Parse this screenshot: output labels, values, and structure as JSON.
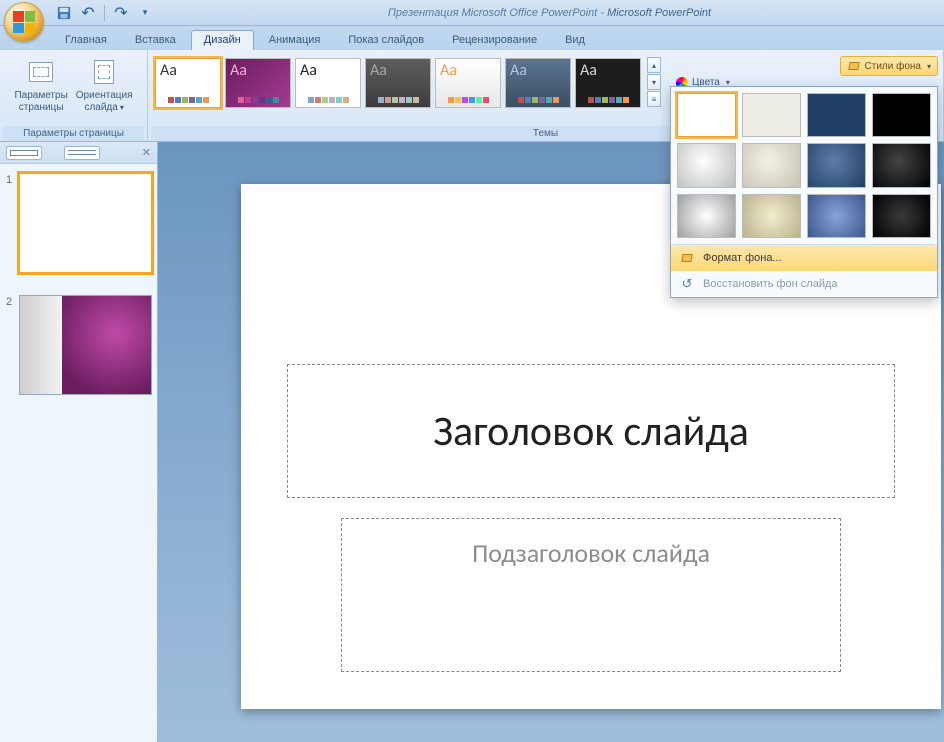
{
  "title": {
    "doc": "Презентация Microsoft Office PowerPoint",
    "app": "Microsoft PowerPoint"
  },
  "tabs": [
    {
      "label": "Главная"
    },
    {
      "label": "Вставка"
    },
    {
      "label": "Дизайн"
    },
    {
      "label": "Анимация"
    },
    {
      "label": "Показ слайдов"
    },
    {
      "label": "Рецензирование"
    },
    {
      "label": "Вид"
    }
  ],
  "ribbon": {
    "page_params": {
      "label": "Параметры страницы",
      "btn_page": [
        "Параметры",
        "страницы"
      ],
      "btn_orient": [
        "Ориентация",
        "слайда"
      ]
    },
    "themes": {
      "label": "Темы",
      "items": [
        {
          "aa_color": "#333333",
          "bg": "#ffffff",
          "swatches": [
            "#c0504d",
            "#4f81bd",
            "#9bbb59",
            "#8064a2",
            "#4bacc6",
            "#f79646"
          ]
        },
        {
          "aa_color": "#fbacd9",
          "bg": "linear-gradient(135deg,#6a1d60,#a43a90)",
          "swatches": [
            "#e3609e",
            "#c43a90",
            "#8a3a90",
            "#5d3a90",
            "#3a5f90",
            "#3a909e"
          ]
        },
        {
          "aa_color": "#222222",
          "bg": "#ffffff",
          "swatches": [
            "#7aa6d0",
            "#d07a7a",
            "#a6d07a",
            "#c6a6d0",
            "#7ad0c6",
            "#d0b07a"
          ]
        },
        {
          "aa_color": "#a8a8a8",
          "bg": "linear-gradient(#5e5e5e,#3c3c3c)",
          "swatches": [
            "#9bb1c9",
            "#c99b9b",
            "#b1c99b",
            "#c5b1c9",
            "#9bc9c5",
            "#c9bb9b"
          ]
        },
        {
          "aa_color": "#f79646",
          "bg": "linear-gradient(#ffffff,#e8e8e8)",
          "swatches": [
            "#f79646",
            "#f7c146",
            "#c146f7",
            "#4693f7",
            "#46f7a4",
            "#f74672"
          ]
        },
        {
          "aa_color": "#b4c6dc",
          "bg": "linear-gradient(#5a748f,#3b4f65)",
          "swatches": [
            "#c0504d",
            "#4f81bd",
            "#9bbb59",
            "#8064a2",
            "#4bacc6",
            "#f79646"
          ]
        },
        {
          "aa_color": "#d8d8d8",
          "bg": "#1d1d1d",
          "swatches": [
            "#c0504d",
            "#4f81bd",
            "#9bbb59",
            "#8064a2",
            "#4bacc6",
            "#f79646"
          ]
        }
      ],
      "colors_btn": "Цвета"
    },
    "bg_styles": {
      "button": "Стили фона",
      "format_bg": "Формат фона...",
      "restore_bg": "Восстановить фон слайда",
      "cells": [
        "#ffffff",
        "#eeeee4",
        "#1f3f66",
        "#000000",
        "radial-gradient(circle at 45% 40%, #ffffff, #bcbcbc)",
        "radial-gradient(circle at 45% 40%, #f5f1e4, #c6c2b4)",
        "radial-gradient(circle at 45% 40%, #5d7da7, #1f3f66)",
        "radial-gradient(circle at 45% 40%, #444444, #000000)",
        "radial-gradient(circle at 50% 50%, #ffffff, #9f9f9f)",
        "radial-gradient(circle at 50% 50%, #f2edce, #b8b28c)",
        "radial-gradient(circle at 50% 50%, #8aa4d6, #3a5790)",
        "radial-gradient(circle at 50% 50%, #3a3a3a, #000000)"
      ]
    }
  },
  "thumbs": [
    "1",
    "2"
  ],
  "slide": {
    "title_placeholder": "Заголовок слайда",
    "subtitle_placeholder": "Подзаголовок слайда"
  }
}
